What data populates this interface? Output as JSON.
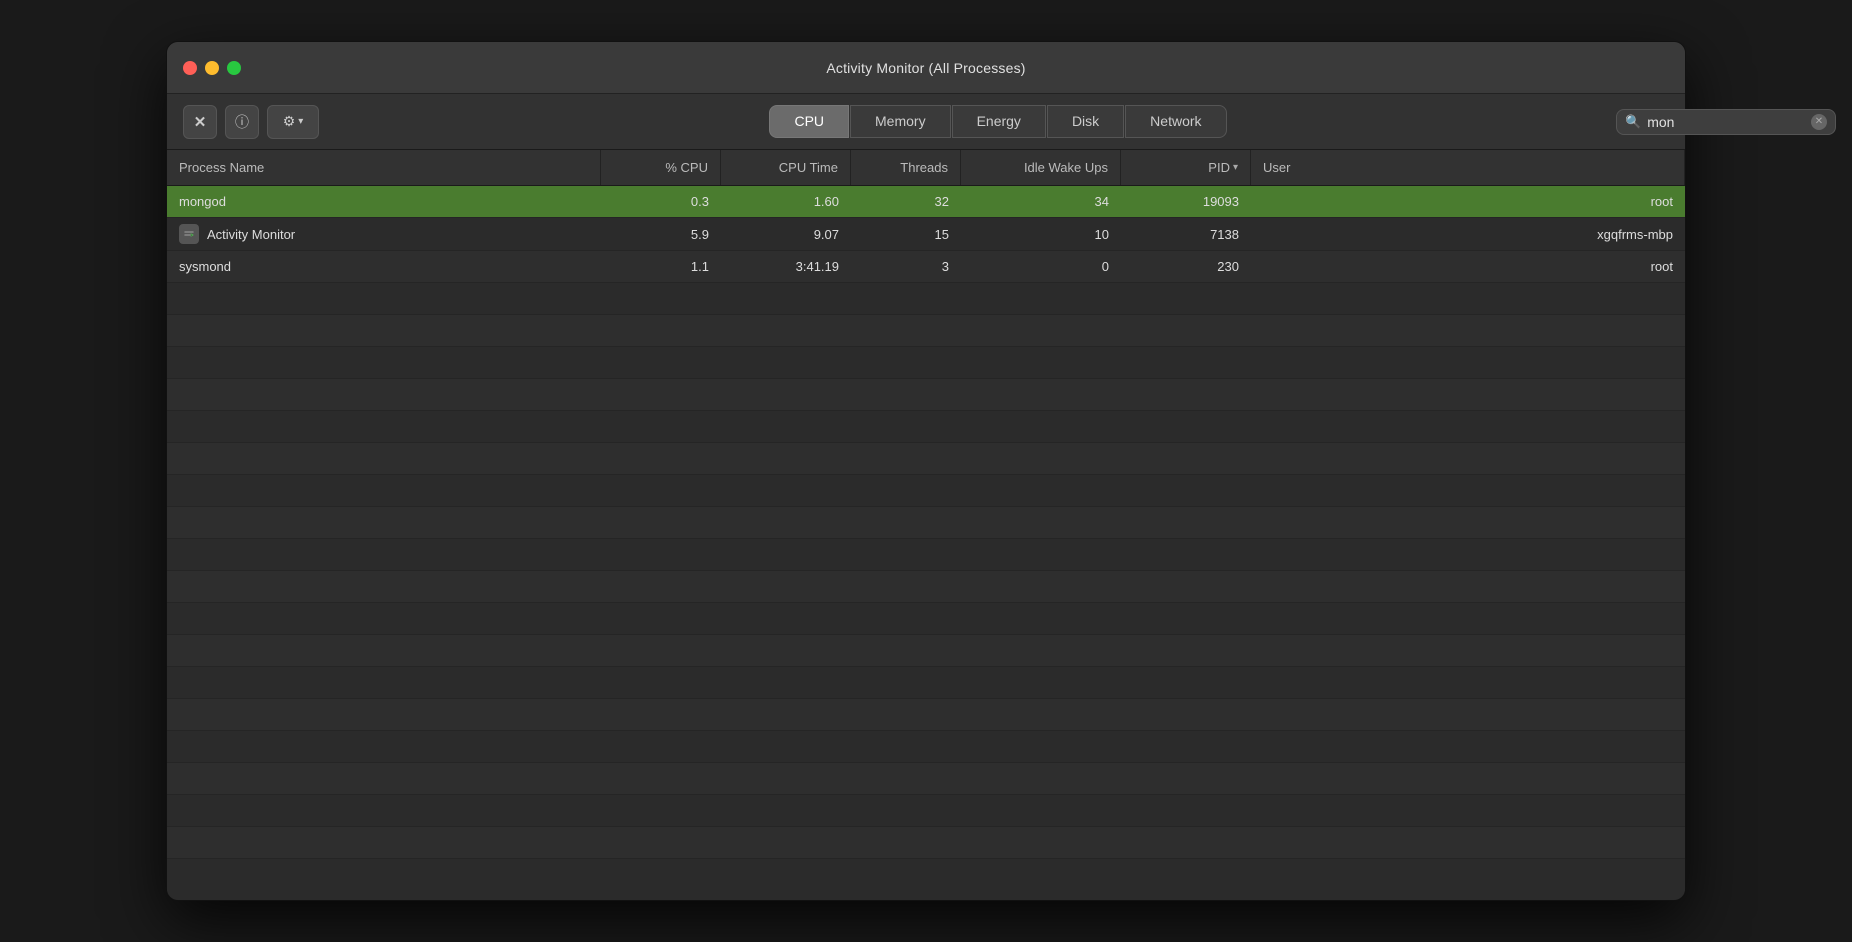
{
  "window": {
    "title": "Activity Monitor (All Processes)"
  },
  "toolbar": {
    "close_btn": "✕",
    "info_btn": "ⓘ",
    "gear_btn": "⚙",
    "gear_arrow": "▾"
  },
  "tabs": [
    {
      "id": "cpu",
      "label": "CPU",
      "active": true
    },
    {
      "id": "memory",
      "label": "Memory",
      "active": false
    },
    {
      "id": "energy",
      "label": "Energy",
      "active": false
    },
    {
      "id": "disk",
      "label": "Disk",
      "active": false
    },
    {
      "id": "network",
      "label": "Network",
      "active": false
    }
  ],
  "search": {
    "value": "mon",
    "placeholder": "Search"
  },
  "table": {
    "columns": [
      {
        "id": "process_name",
        "label": "Process Name",
        "align": "left"
      },
      {
        "id": "cpu_pct",
        "label": "% CPU",
        "align": "right"
      },
      {
        "id": "cpu_time",
        "label": "CPU Time",
        "align": "right"
      },
      {
        "id": "threads",
        "label": "Threads",
        "align": "right"
      },
      {
        "id": "idle_wake_ups",
        "label": "Idle Wake Ups",
        "align": "right"
      },
      {
        "id": "pid",
        "label": "PID",
        "align": "right",
        "sort": true,
        "sort_dir": "desc"
      },
      {
        "id": "user",
        "label": "User",
        "align": "left"
      }
    ],
    "rows": [
      {
        "selected": true,
        "process_name": "mongod",
        "has_icon": false,
        "cpu_pct": "0.3",
        "cpu_time": "1.60",
        "threads": "32",
        "idle_wake_ups": "34",
        "pid": "19093",
        "user": "root"
      },
      {
        "selected": false,
        "process_name": "Activity Monitor",
        "has_icon": true,
        "cpu_pct": "5.9",
        "cpu_time": "9.07",
        "threads": "15",
        "idle_wake_ups": "10",
        "pid": "7138",
        "user": "xgqfrms-mbp"
      },
      {
        "selected": false,
        "process_name": "sysmond",
        "has_icon": false,
        "cpu_pct": "1.1",
        "cpu_time": "3:41.19",
        "threads": "3",
        "idle_wake_ups": "0",
        "pid": "230",
        "user": "root"
      }
    ]
  }
}
